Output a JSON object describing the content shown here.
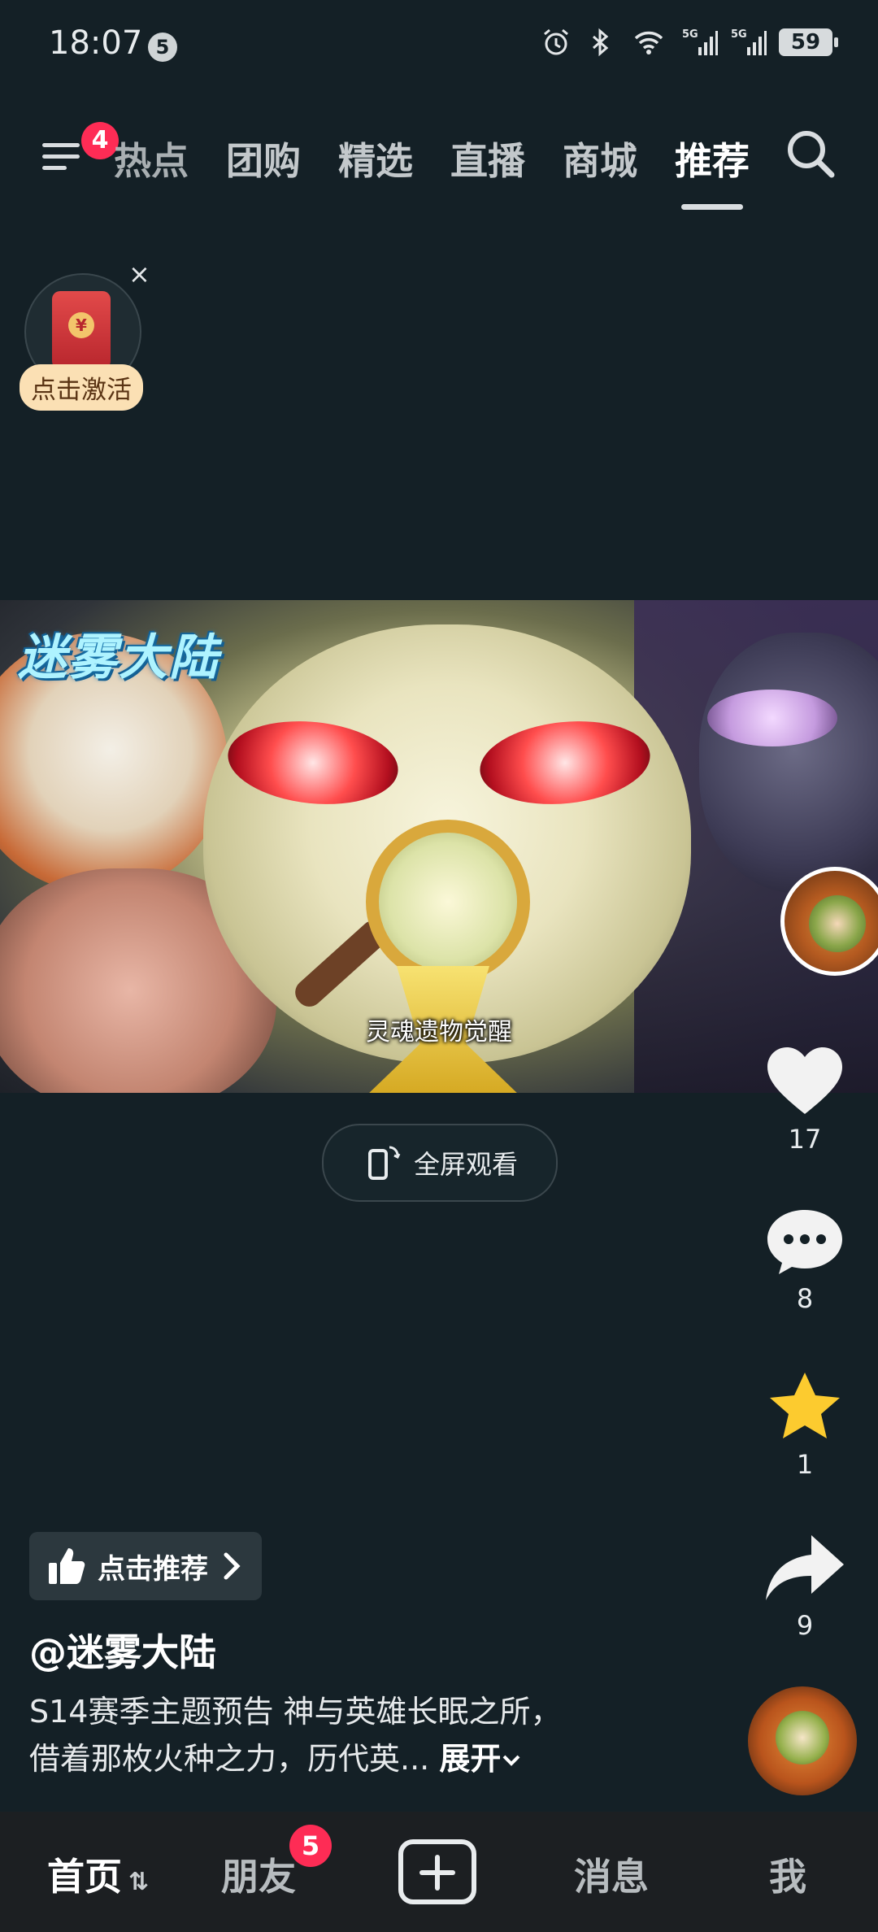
{
  "status_bar": {
    "time": "18:07",
    "notification_count": "5",
    "battery": "59",
    "icons": [
      "alarm-icon",
      "bluetooth-icon",
      "wifi-icon",
      "signal-5g-icon",
      "signal-5g-icon"
    ]
  },
  "top_nav": {
    "menu_badge": "4",
    "tabs": [
      {
        "label": "热点",
        "partial": true
      },
      {
        "label": "团购"
      },
      {
        "label": "精选"
      },
      {
        "label": "直播"
      },
      {
        "label": "商城"
      },
      {
        "label": "推荐",
        "active": true
      }
    ]
  },
  "red_packet": {
    "label": "点击激活",
    "close": "×",
    "coin": "¥"
  },
  "video": {
    "logo": "迷雾大陆",
    "subtitle": "灵魂遗物觉醒"
  },
  "fullscreen_button": {
    "label": "全屏观看"
  },
  "actions": {
    "likes": "17",
    "comments": "8",
    "favorites": "1",
    "shares": "9"
  },
  "post": {
    "recommend_label": "点击推荐",
    "author": "@迷雾大陆",
    "description_line1": "S14赛季主题预告 神与英雄长眠之所，",
    "description_line2": "借着那枚火种之力，历代英...",
    "expand_label": "展开"
  },
  "bottom_tabs": {
    "home": "首页",
    "friends": "朋友",
    "friends_badge": "5",
    "messages": "消息",
    "me": "我"
  },
  "colors": {
    "background": "#142026",
    "badge": "#fe2c55",
    "star": "#fccb2f",
    "tabbar": "#1c1f22"
  }
}
